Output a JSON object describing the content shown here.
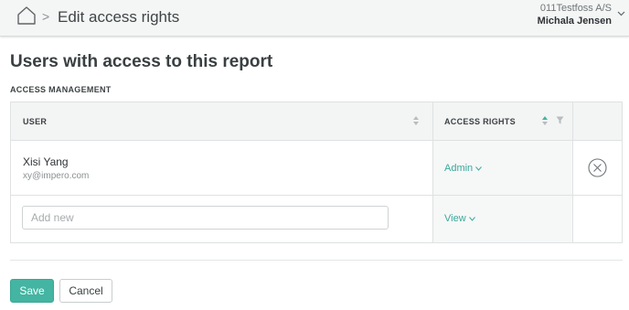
{
  "header": {
    "breadcrumb_separator": ">",
    "title": "Edit access rights",
    "organization": "011Testfoss A/S",
    "user_name": "Michala Jensen"
  },
  "main": {
    "heading": "Users with access to this report",
    "section_label": "ACCESS MANAGEMENT",
    "table": {
      "columns": [
        "USER",
        "ACCESS RIGHTS"
      ],
      "rows": [
        {
          "name": "Xisi Yang",
          "email": "xy@impero.com",
          "access": "Admin"
        }
      ],
      "new_row": {
        "placeholder": "Add new",
        "value": "",
        "access": "View"
      }
    }
  },
  "actions": {
    "save_label": "Save",
    "cancel_label": "Cancel"
  },
  "colors": {
    "accent": "#43b5a2",
    "link": "#3aa99a",
    "header_bg": "#f4f5f5"
  },
  "icons": [
    "home-icon",
    "chevron-down-icon",
    "sort-icon",
    "filter-icon",
    "remove-circle-icon"
  ]
}
